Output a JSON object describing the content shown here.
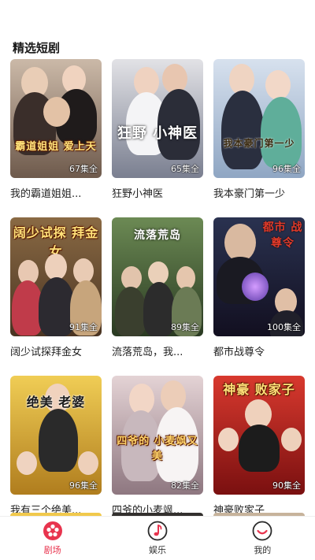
{
  "section": {
    "title": "精选短剧"
  },
  "dramas": [
    {
      "title": "我的霸道姐姐...",
      "episodes": "67集全",
      "overlay": "霸道姐姐 爱上天",
      "bg": [
        "#b7a595",
        "#6e5a4c"
      ]
    },
    {
      "title": "狂野小神医",
      "episodes": "65集全",
      "overlay": "狂野 小神医",
      "bg": [
        "#d9d9de",
        "#7a7f90"
      ]
    },
    {
      "title": "我本豪门第一少",
      "episodes": "96集全",
      "overlay": "我本豪门第一少",
      "bg": [
        "#c9d5e6",
        "#8fa6c3"
      ]
    },
    {
      "title": "阔少试探拜金女",
      "episodes": "91集全",
      "overlay": "阔少试探 拜金女",
      "bg": [
        "#7a5a3a",
        "#4a3422"
      ]
    },
    {
      "title": "流落荒岛，我...",
      "episodes": "89集全",
      "overlay": "流落荒岛",
      "bg": [
        "#4c6a3c",
        "#2a3a22"
      ]
    },
    {
      "title": "都市战尊令",
      "episodes": "100集全",
      "overlay": "都市 战尊令",
      "bg": [
        "#2a3250",
        "#120f20"
      ]
    },
    {
      "title": "我有三个绝美...",
      "episodes": "96集全",
      "overlay": "绝美 老婆",
      "bg": [
        "#e5c14a",
        "#b07d1e"
      ]
    },
    {
      "title": "四爷的小麦飒...",
      "episodes": "82集全",
      "overlay": "四爷的 小麦飒又美",
      "bg": [
        "#d8c6c8",
        "#8e7780"
      ]
    },
    {
      "title": "神豪败家子",
      "episodes": "90集全",
      "overlay": "神豪 败家子",
      "bg": [
        "#c92c22",
        "#7a1010"
      ]
    }
  ],
  "tabbar": {
    "tabs": [
      {
        "label": "剧场",
        "active": true
      },
      {
        "label": "娱乐",
        "active": false
      },
      {
        "label": "我的",
        "active": false
      }
    ]
  },
  "colors": {
    "accent": "#e8344e"
  }
}
